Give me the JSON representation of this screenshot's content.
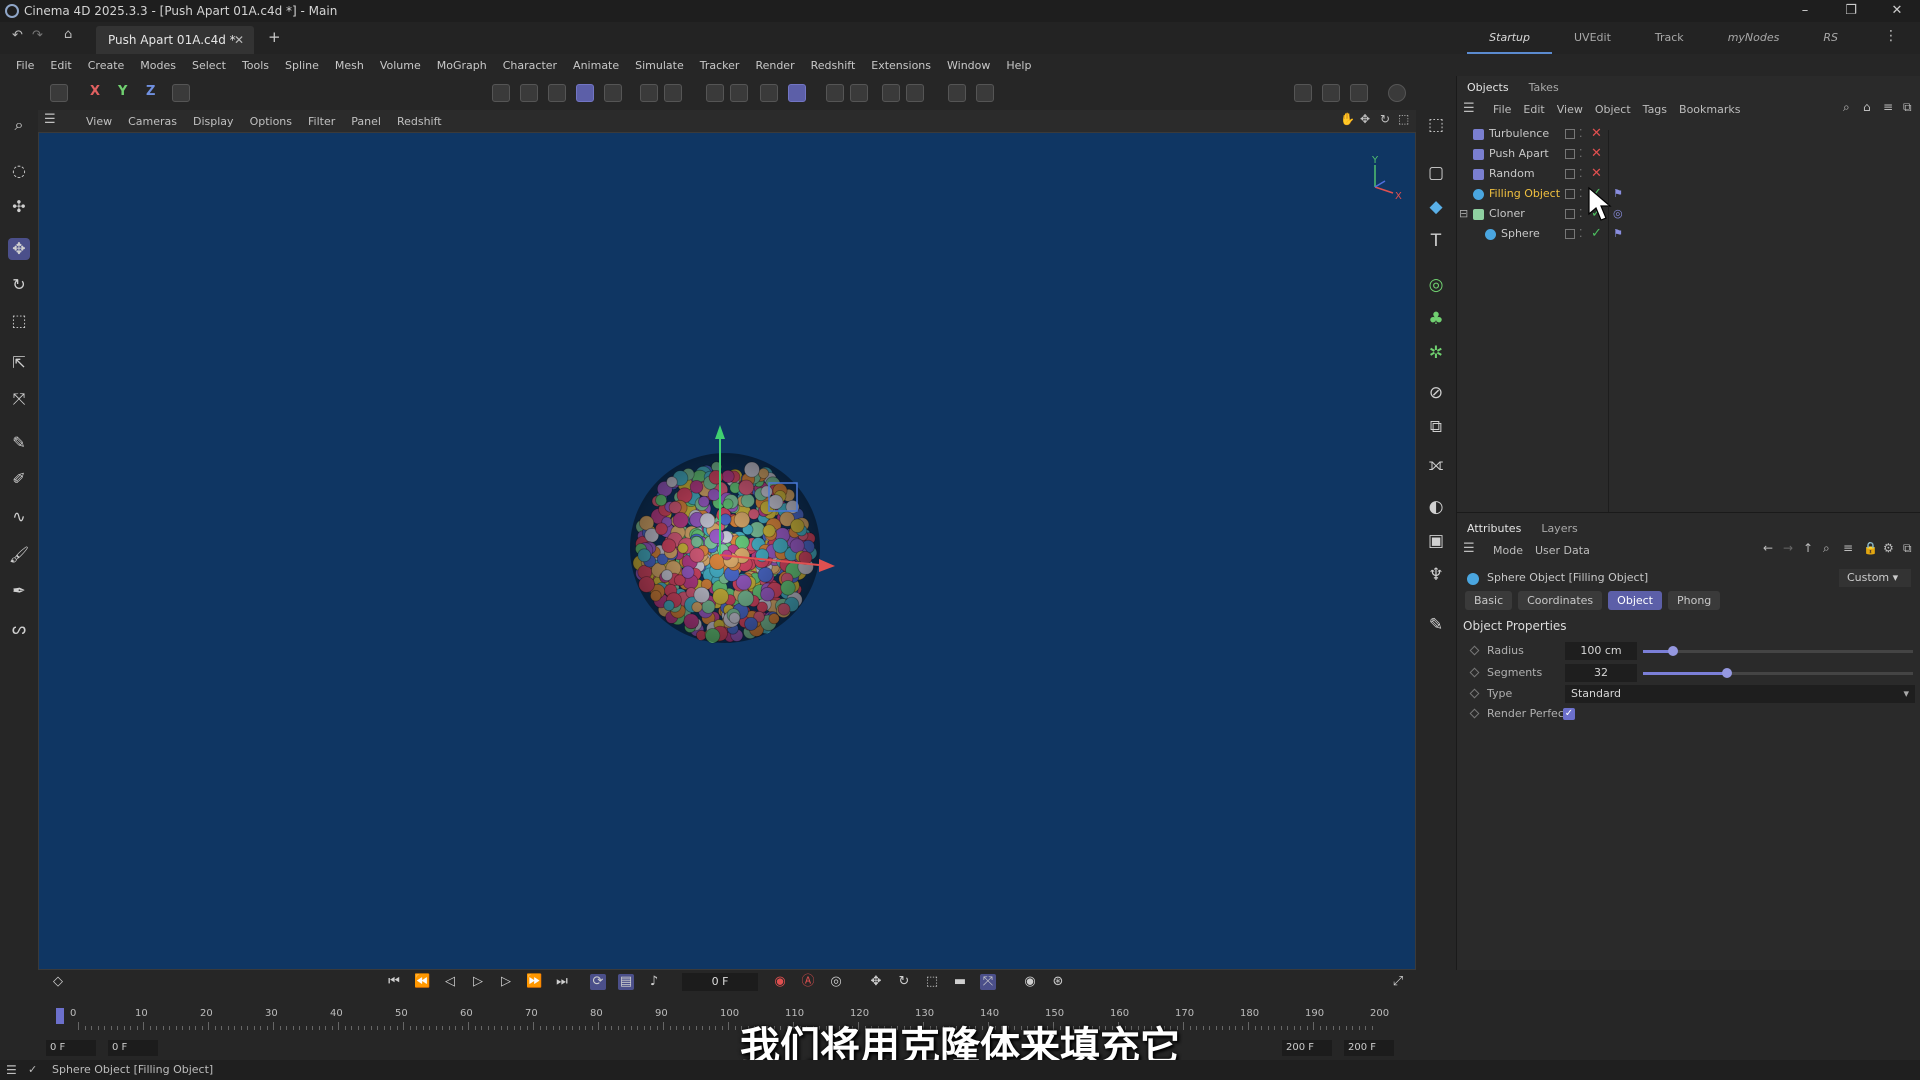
{
  "window": {
    "title": "Cinema 4D 2025.3.3 - [Push Apart 01A.c4d *] - Main",
    "controls": [
      "–",
      "❐",
      "✕"
    ]
  },
  "tabs": {
    "document_tab": "Push Apart 01A.c4d *",
    "add_tab": "+",
    "layouts": [
      "Startup",
      "UVEdit",
      "Track",
      "myNodes",
      "RS"
    ]
  },
  "menu": [
    "File",
    "Edit",
    "Create",
    "Modes",
    "Select",
    "Tools",
    "Spline",
    "Mesh",
    "Volume",
    "MoGraph",
    "Character",
    "Animate",
    "Simulate",
    "Tracker",
    "Render",
    "Redshift",
    "Extensions",
    "Window",
    "Help"
  ],
  "toolbar": {
    "axes": [
      "X",
      "Y",
      "Z"
    ]
  },
  "viewport": {
    "menu": [
      "View",
      "Cameras",
      "Display",
      "Options",
      "Filter",
      "Panel",
      "Redshift"
    ],
    "axis_y": "Y",
    "axis_x": "X"
  },
  "objects_panel": {
    "tabs": [
      "Objects",
      "Takes"
    ],
    "menu": [
      "File",
      "Edit",
      "View",
      "Object",
      "Tags",
      "Bookmarks"
    ],
    "items": [
      {
        "name": "Turbulence",
        "status": "✕",
        "status_color": "#e05050",
        "icon_color": "#7a7fd0",
        "indent": 0
      },
      {
        "name": "Push Apart",
        "status": "✕",
        "status_color": "#e05050",
        "icon_color": "#7a7fd0",
        "indent": 0
      },
      {
        "name": "Random",
        "status": "✕",
        "status_color": "#e05050",
        "icon_color": "#7a7fd0",
        "indent": 0
      },
      {
        "name": "Filling Object",
        "status": "✓",
        "status_color": "#4cc060",
        "icon_color": "#4aa6e0",
        "indent": 0,
        "highlight": true
      },
      {
        "name": "Cloner",
        "status": "✓",
        "status_color": "#4cc060",
        "icon_color": "#8fd0a0",
        "indent": 0,
        "expand": "⊟"
      },
      {
        "name": "Sphere",
        "status": "✓",
        "status_color": "#4cc060",
        "icon_color": "#4aa6e0",
        "indent": 1
      }
    ]
  },
  "attributes_panel": {
    "tabs": [
      "Attributes",
      "Layers"
    ],
    "menu": [
      "Mode",
      "User Data"
    ],
    "preset": "Custom",
    "object_title": "Sphere Object [Filling Object]",
    "subtabs": [
      "Basic",
      "Coordinates",
      "Object",
      "Phong"
    ],
    "active_subtab": "Object",
    "section": "Object Properties",
    "props": {
      "radius_label": "Radius",
      "radius_value": "100 cm",
      "radius_slider": 0.11,
      "segments_label": "Segments",
      "segments_value": "32",
      "segments_slider": 0.31,
      "type_label": "Type",
      "type_value": "Standard",
      "render_perfect_label": "Render Perfect",
      "render_perfect_checked": true
    }
  },
  "timeline": {
    "current_frame": "0 F",
    "ticks": [
      "0",
      "10",
      "20",
      "30",
      "40",
      "50",
      "60",
      "70",
      "80",
      "90",
      "100",
      "110",
      "120",
      "130",
      "140",
      "150",
      "160",
      "170",
      "180",
      "190",
      "200"
    ],
    "start_a": "0 F",
    "start_b": "0 F",
    "end_a": "200 F",
    "end_b": "200 F"
  },
  "status_bar": {
    "text": "Sphere Object [Filling Object]"
  },
  "subtitle": "我们将用克隆体来填充它",
  "colors": {
    "accent": "#5c5fa8",
    "viewport_bg": "#0f3663",
    "highlight_name": "#f0c040"
  }
}
